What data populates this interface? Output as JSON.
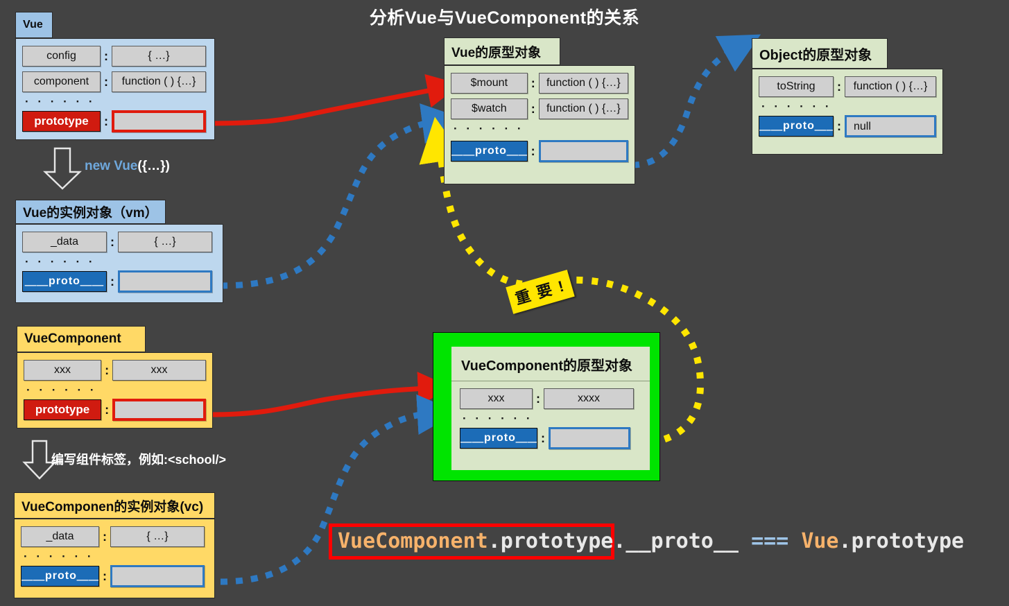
{
  "page": {
    "title": "分析Vue与VueComponent的关系",
    "background_color": "#434343"
  },
  "colors": {
    "accent_red": "#e01b0d",
    "accent_blue": "#2e79c2",
    "accent_yellow": "#ffd966",
    "accent_green": "#00e400",
    "proto_key_blue": "#1c6cb7",
    "prototype_key_red": "#d01b10",
    "card_blue_body": "#bdd7ee",
    "card_green_body": "#d9e6c8"
  },
  "cards": {
    "vue": {
      "title": "Vue",
      "rows": [
        {
          "key": "config",
          "value": "{ …}"
        },
        {
          "key": "component",
          "value": "function ( ) {…}"
        }
      ],
      "ellipsis": "· · · · · ·",
      "special": {
        "key": "prototype",
        "value": ""
      }
    },
    "vue_instance": {
      "title": "Vue的实例对象（vm）",
      "rows": [
        {
          "key": "_data",
          "value": "{ …}"
        }
      ],
      "ellipsis": "· · · · · ·",
      "special": {
        "key": "＿＿proto＿＿",
        "value": ""
      }
    },
    "vuecomponent": {
      "title": "VueComponent",
      "rows": [
        {
          "key": "xxx",
          "value": "xxx"
        }
      ],
      "ellipsis": "· · · · · ·",
      "special": {
        "key": "prototype",
        "value": ""
      }
    },
    "vc_instance": {
      "title": "VueComponen的实例对象(vc)",
      "rows": [
        {
          "key": "_data",
          "value": "{ …}"
        }
      ],
      "ellipsis": "· · · · · ·",
      "special": {
        "key": "＿＿proto＿＿",
        "value": ""
      }
    },
    "vue_prototype": {
      "title": "Vue的原型对象",
      "rows": [
        {
          "key": "$mount",
          "value": "function ( ) {…}"
        },
        {
          "key": "$watch",
          "value": "function ( ) {…}"
        }
      ],
      "ellipsis": "· · · · · ·",
      "special": {
        "key": "＿＿proto＿＿",
        "value": ""
      }
    },
    "object_prototype": {
      "title": "Object的原型对象",
      "rows": [
        {
          "key": "toString",
          "value": "function ( ) {…}"
        }
      ],
      "ellipsis": "· · · · · ·",
      "special": {
        "key": "＿＿proto＿＿",
        "value": "null"
      }
    },
    "vuecomponent_prototype": {
      "title": "VueComponent的原型对象",
      "rows": [
        {
          "key": "xxx",
          "value": "xxxx"
        }
      ],
      "ellipsis": "· · · · · ·",
      "special": {
        "key": "＿＿proto＿＿",
        "value": ""
      }
    }
  },
  "steps": {
    "new_vue_prefix": "new Vue",
    "new_vue_suffix": "({…})",
    "write_component_tag": "编写组件标签，例如:<school/>"
  },
  "badge": {
    "important": "重 要 !"
  },
  "equation": {
    "part1": "VueComponent",
    "part2": ".prototype",
    "part3": ".__proto__",
    "operator": "===",
    "part4": "Vue",
    "part5": ".prototype"
  }
}
